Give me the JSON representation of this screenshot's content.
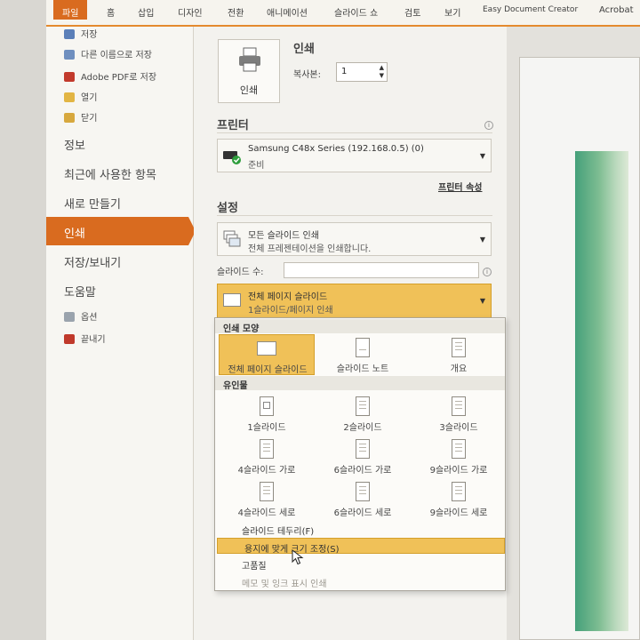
{
  "ribbon": {
    "tabs": [
      "파일",
      "홈",
      "삽입",
      "디자인",
      "전환",
      "애니메이션",
      "슬라이드 쇼",
      "검토",
      "보기",
      "Easy Document Creator",
      "Acrobat"
    ],
    "active_tab": "파일"
  },
  "backstage_nav": {
    "top_items": [
      "저장",
      "다른 이름으로 저장",
      "Adobe PDF로 저장",
      "열기",
      "닫기"
    ],
    "sections": [
      "정보",
      "최근에 사용한 항목",
      "새로 만들기",
      "인쇄",
      "저장/보내기",
      "도움말"
    ],
    "active": "인쇄",
    "bottom_items": [
      "옵션",
      "끝내기"
    ]
  },
  "print": {
    "title": "인쇄",
    "print_button_label": "인쇄",
    "copies_label": "복사본:",
    "copies_value": "1"
  },
  "printer": {
    "header": "프린터",
    "name": "Samsung C48x Series (192.168.0.5) (0)",
    "status": "준비",
    "properties_link": "프린터 속성"
  },
  "settings": {
    "header": "설정",
    "range": {
      "line1": "모든 슬라이드 인쇄",
      "line2": "전체 프레젠테이션을 인쇄합니다."
    },
    "slides_label": "슬라이드 수:",
    "slides_value": "",
    "layout": {
      "line1": "전체 페이지 슬라이드",
      "line2": "1슬라이드/페이지 인쇄"
    }
  },
  "layout_menu": {
    "print_layout_header": "인쇄 모양",
    "print_layout_options": [
      "전체 페이지 슬라이드",
      "슬라이드 노트",
      "개요"
    ],
    "selected_layout": "전체 페이지 슬라이드",
    "handouts_header": "유인물",
    "handout_options": [
      "1슬라이드",
      "2슬라이드",
      "3슬라이드",
      "4슬라이드 가로",
      "6슬라이드 가로",
      "9슬라이드 가로",
      "4슬라이드 세로",
      "6슬라이드 세로",
      "9슬라이드 세로"
    ],
    "menu_items": [
      "슬라이드 테두리(F)",
      "용지에 맞게 크기 조정(S)",
      "고품질",
      "메모 및 잉크 표시 인쇄"
    ],
    "highlighted_item": "용지에 맞게 크기 조정(S)",
    "disabled_item": "메모 및 잉크 표시 인쇄"
  },
  "colors": {
    "accent": "#d96b1f",
    "highlight": "#f0c158"
  },
  "icons": [
    "printer-icon",
    "info-icon",
    "chevron-down-icon",
    "pointer-cursor-icon",
    "save-icon",
    "folder-icon"
  ]
}
